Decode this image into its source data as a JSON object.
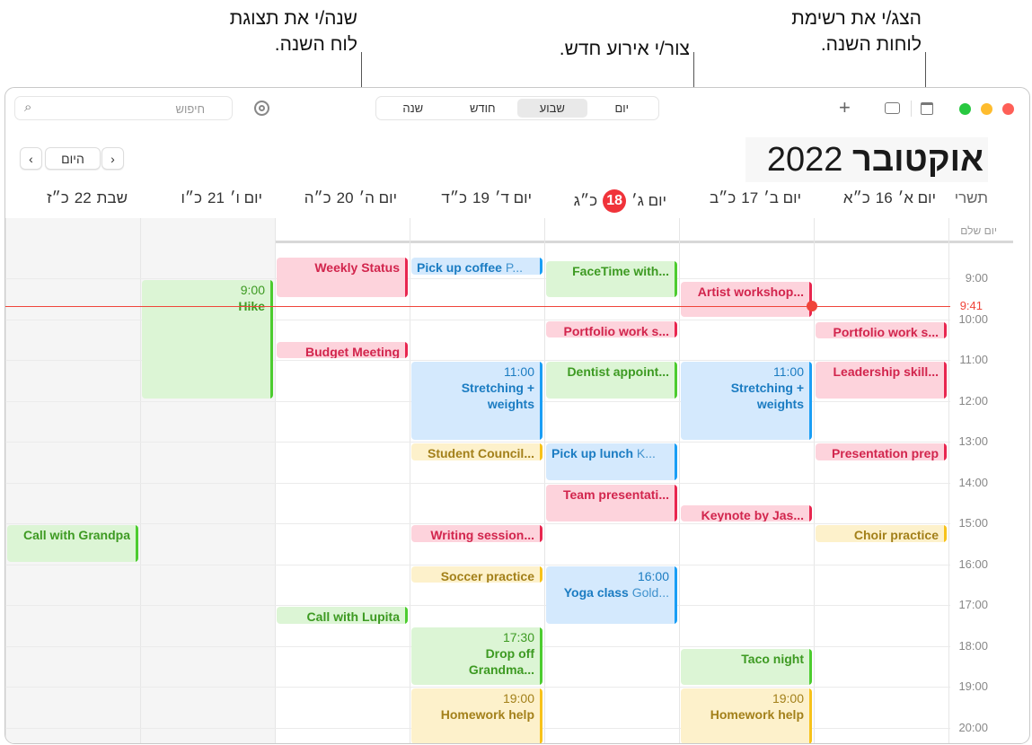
{
  "callouts": {
    "year_view": [
      "שנה/י את תצוגת",
      "לוח השנה."
    ],
    "new_event": "צור/י אירוע חדש.",
    "calendar_list": [
      "הצג/י את רשימת",
      "לוחות השנה."
    ]
  },
  "toolbar": {
    "search_placeholder": "חיפוש",
    "views": [
      {
        "label": "יום",
        "selected": false
      },
      {
        "label": "שבוע",
        "selected": true
      },
      {
        "label": "חודש",
        "selected": false
      },
      {
        "label": "שנה",
        "selected": false
      }
    ],
    "icons": [
      "calendar-list-icon",
      "inbox-icon",
      "plus-icon",
      "airdrop-icon",
      "search-icon"
    ]
  },
  "header": {
    "month": "אוקטובר",
    "year": "2022",
    "today_button": "היום",
    "prev": "‹",
    "next": "›",
    "hebrew_month": "תשרי"
  },
  "days": [
    {
      "name": "יום א׳",
      "num": "16",
      "heb": "כ״א"
    },
    {
      "name": "יום ב׳",
      "num": "17",
      "heb": "כ״ב"
    },
    {
      "name": "יום ג׳",
      "num": "18",
      "heb": "כ״ג",
      "today": true
    },
    {
      "name": "יום ד׳",
      "num": "19",
      "heb": "כ״ד"
    },
    {
      "name": "יום ה׳",
      "num": "20",
      "heb": "כ״ה"
    },
    {
      "name": "יום ו׳",
      "num": "21",
      "heb": "כ״ו"
    },
    {
      "name": "שבת",
      "num": "22",
      "heb": "כ״ז"
    }
  ],
  "all_day_label": "יום שלם",
  "hours": [
    "9:00",
    "10:00",
    "11:00",
    "12:00",
    "13:00",
    "14:00",
    "15:00",
    "16:00",
    "17:00",
    "18:00",
    "19:00",
    "20:00"
  ],
  "now": "9:41",
  "colors": {
    "red": {
      "bg": "#fdd3dc",
      "fg": "#d2254d",
      "bar": "#e8264f"
    },
    "green": {
      "bg": "#dcf5d5",
      "fg": "#3d9a22",
      "bar": "#4ccc2f"
    },
    "blue": {
      "bg": "#d4e9fd",
      "fg": "#1b7cc2",
      "bar": "#1a9ef5"
    },
    "yellow": {
      "bg": "#fdf1cb",
      "fg": "#a3801a",
      "bar": "#f7c21a"
    },
    "now": "#f0443a"
  },
  "events": [
    {
      "day": 0,
      "start": "10:05",
      "end": "10:30",
      "title": "Portfolio work s...",
      "color": "red"
    },
    {
      "day": 0,
      "start": "11:03",
      "end": "12:00",
      "title": "Leadership skill...",
      "color": "red"
    },
    {
      "day": 0,
      "start": "13:03",
      "end": "13:30",
      "title": "Presentation prep",
      "color": "red"
    },
    {
      "day": 0,
      "start": "15:03",
      "end": "15:30",
      "title": "Choir practice",
      "color": "yellow"
    },
    {
      "day": 1,
      "start": "9:05",
      "end": "10:00",
      "title": "Artist workshop...",
      "color": "red"
    },
    {
      "day": 1,
      "start": "11:03",
      "end": "13:00",
      "time": "11:00",
      "title": "Stretching + weights",
      "color": "blue"
    },
    {
      "day": 1,
      "start": "14:33",
      "end": "15:00",
      "title": "Keynote by Jas...",
      "color": "red"
    },
    {
      "day": 1,
      "start": "18:05",
      "end": "19:00",
      "title": "Taco night",
      "color": "green"
    },
    {
      "day": 1,
      "start": "19:03",
      "end": "21:00",
      "time": "19:00",
      "title": "Homework help",
      "color": "yellow"
    },
    {
      "day": 2,
      "start": "8:35",
      "end": "9:30",
      "title": "FaceTime with...",
      "color": "green"
    },
    {
      "day": 2,
      "start": "10:03",
      "end": "10:30",
      "title": "Portfolio work s...",
      "color": "red"
    },
    {
      "day": 2,
      "start": "11:03",
      "end": "12:00",
      "title": "Dentist appoint...",
      "color": "green"
    },
    {
      "day": 2,
      "start": "13:03",
      "end": "14:00",
      "title": "Pick up lunch",
      "location": "K...",
      "color": "blue"
    },
    {
      "day": 2,
      "start": "14:03",
      "end": "15:00",
      "title": "Team presentati...",
      "color": "red"
    },
    {
      "day": 2,
      "start": "16:03",
      "end": "17:30",
      "time": "16:00",
      "title": "Yoga class",
      "location": "Gold...",
      "color": "blue"
    },
    {
      "day": 3,
      "start": "8:30",
      "end": "8:58",
      "title": "Pick up coffee",
      "location": "P...",
      "color": "blue"
    },
    {
      "day": 3,
      "start": "11:03",
      "end": "13:00",
      "time": "11:00",
      "title": "Stretching + weights",
      "color": "blue"
    },
    {
      "day": 3,
      "start": "13:03",
      "end": "13:30",
      "title": "Student Council...",
      "color": "yellow"
    },
    {
      "day": 3,
      "start": "15:03",
      "end": "15:30",
      "title": "Writing session...",
      "color": "red"
    },
    {
      "day": 3,
      "start": "16:03",
      "end": "16:30",
      "title": "Soccer practice",
      "color": "yellow"
    },
    {
      "day": 3,
      "start": "17:33",
      "end": "19:00",
      "time": "17:30",
      "title": "Drop off Grandma...",
      "color": "green"
    },
    {
      "day": 3,
      "start": "19:03",
      "end": "21:00",
      "time": "19:00",
      "title": "Homework help",
      "color": "yellow"
    },
    {
      "day": 4,
      "start": "8:30",
      "end": "9:30",
      "title": "Weekly Status",
      "color": "red"
    },
    {
      "day": 4,
      "start": "10:33",
      "end": "11:00",
      "title": "Budget Meeting",
      "color": "red"
    },
    {
      "day": 4,
      "start": "17:03",
      "end": "17:30",
      "title": "Call with Lupita",
      "color": "green"
    },
    {
      "day": 5,
      "start": "9:03",
      "end": "12:00",
      "time": "9:00",
      "title": "Hike",
      "color": "green"
    },
    {
      "day": 6,
      "start": "15:03",
      "end": "16:00",
      "title": "Call with Grandpa",
      "color": "green"
    }
  ]
}
